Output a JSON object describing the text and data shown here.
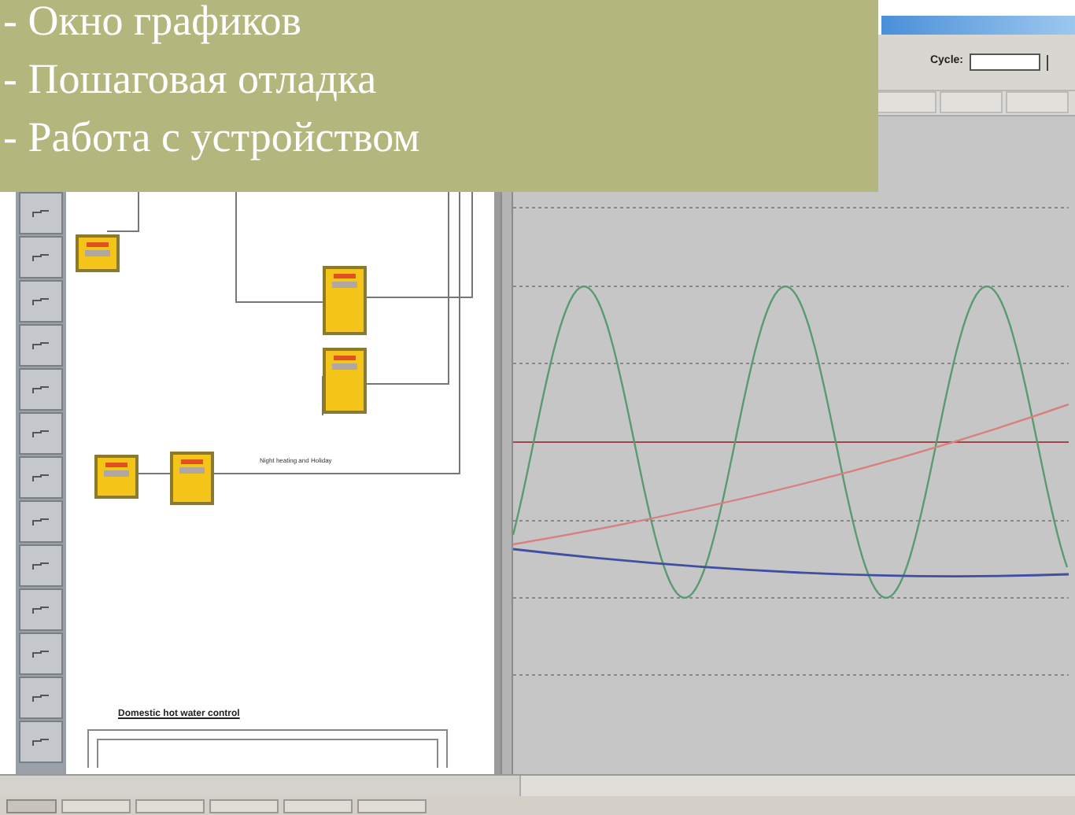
{
  "caption": {
    "lines": [
      "- Окно графиков",
      "- Пошаговая отладка",
      "- Работа с устройством"
    ]
  },
  "toolbar": {
    "cycle_label": "Cycle:"
  },
  "diagram": {
    "connection_label": "Night heating and Holiday",
    "section_title": "Domestic hot water control"
  }
}
